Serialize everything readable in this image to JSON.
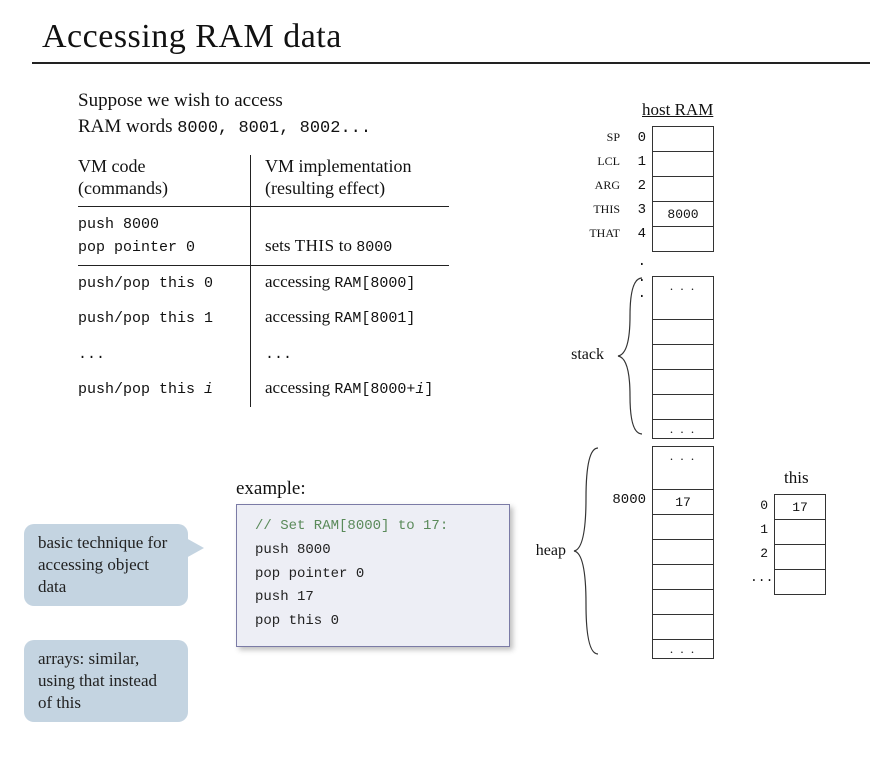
{
  "title_prefix": "Accessing ",
  "title_ram": "RAM",
  "title_suffix": " data",
  "intro_line1": "Suppose we wish to access",
  "intro_line2_prefix": "RAM words ",
  "intro_line2_nums": "8000, 8001, 8002...",
  "table": {
    "header_left_l1": "VM code",
    "header_left_l2": "(commands)",
    "header_right_l1": "VM implementation",
    "header_right_l2": "(resulting effect)",
    "r1_l1": "push 8000",
    "r1_l2": "pop pointer 0",
    "r1_right_prefix": "sets ",
    "r1_right_this": "THIS",
    "r1_right_to": " to ",
    "r1_right_val": "8000",
    "r2_left": "push/pop this 0",
    "r2_right_prefix": "accessing ",
    "r2_right_mono": "RAM[8000]",
    "r3_left": "push/pop this 1",
    "r3_right_prefix": "accessing ",
    "r3_right_mono": "RAM[8001]",
    "r4_left": "...",
    "r4_right": "...",
    "r5_left_prefix": "push/pop this ",
    "r5_left_i": "i",
    "r5_right_prefix": "accessing ",
    "r5_right_mono_open": "RAM[8000+",
    "r5_right_i": "i",
    "r5_right_mono_close": "]"
  },
  "example_label": "example:",
  "code": {
    "comment": "// Set RAM[8000] to 17:",
    "l1": "push 8000",
    "l2": "pop pointer 0",
    "l3": "push 17",
    "l4": "pop this 0"
  },
  "callout1": "basic technique for accessing object data",
  "callout2": "arrays: similar, using that instead of this",
  "ram": {
    "title": "host RAM",
    "seg_sp": "SP",
    "seg_lcl": "LCL",
    "seg_arg": "ARG",
    "seg_this": "THIS",
    "seg_that": "THAT",
    "idx0": "0",
    "idx1": "1",
    "idx2": "2",
    "idx3": "3",
    "idx4": "4",
    "val_this": "8000",
    "dots": ". . .",
    "stack_label": "stack",
    "heap_label": "heap",
    "addr_8000": "8000",
    "val_17": "17"
  },
  "this_segment": {
    "title": "this",
    "idx0": "0",
    "idx1": "1",
    "idx2": "2",
    "idx_dots": "...",
    "val0": "17"
  }
}
